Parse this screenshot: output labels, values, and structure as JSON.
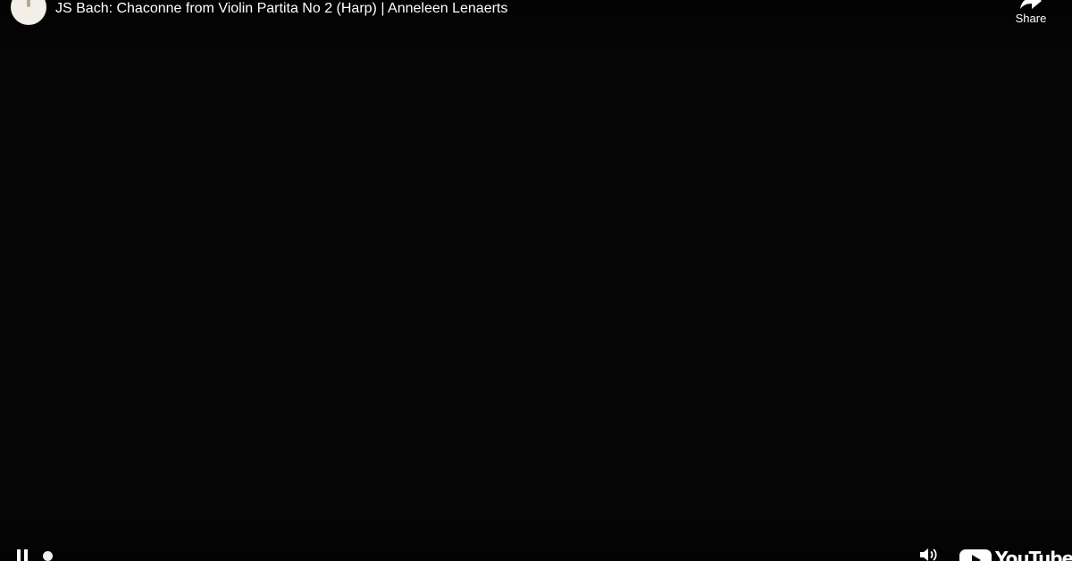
{
  "video": {
    "title": "JS Bach: Chaconne from Violin Partita No 2 (Harp) | Anneleen Lenaerts"
  },
  "actions": {
    "share_label": "Share"
  },
  "controls": {
    "logo_text": "YouTube"
  },
  "icons": {
    "avatar": "channel-avatar",
    "share": "share-arrow-icon",
    "pause": "pause-icon",
    "live": "live-dot-icon",
    "volume": "volume-icon",
    "logo": "youtube-logo"
  },
  "colors": {
    "background": "#060606",
    "text": "#ffffff",
    "logo_play_bg": "#ffffff"
  }
}
